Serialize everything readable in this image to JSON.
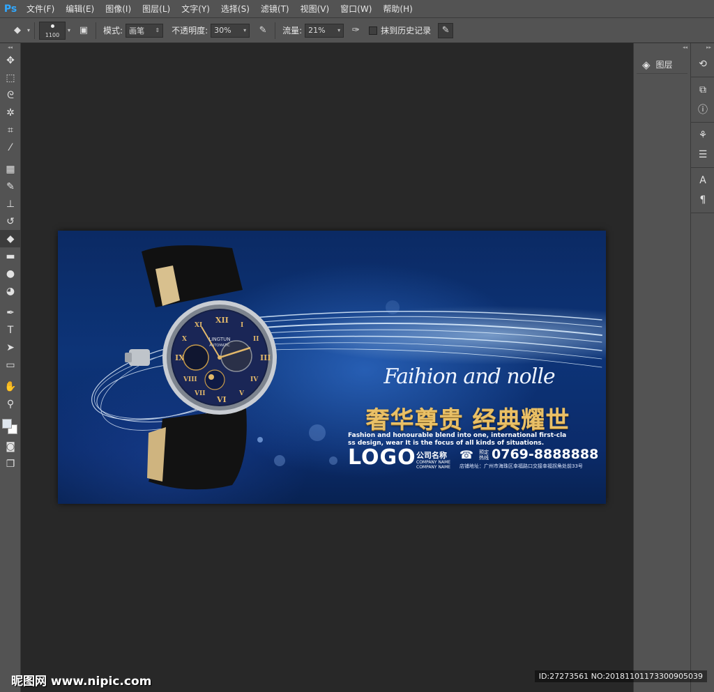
{
  "app": {
    "logo": "Ps"
  },
  "menu": [
    "文件(F)",
    "编辑(E)",
    "图像(I)",
    "图层(L)",
    "文字(Y)",
    "选择(S)",
    "滤镜(T)",
    "视图(V)",
    "窗口(W)",
    "帮助(H)"
  ],
  "options": {
    "brush_size": "1100",
    "mode_label": "模式:",
    "mode_value": "画笔",
    "opacity_label": "不透明度:",
    "opacity_value": "30%",
    "flow_label": "流量:",
    "flow_value": "21%",
    "history_label": "抹到历史记录",
    "history_checked": false
  },
  "tools": [
    {
      "name": "move-tool",
      "glyph": "✥"
    },
    {
      "name": "marquee-tool",
      "glyph": "⬚"
    },
    {
      "name": "lasso-tool",
      "glyph": "ᘓ"
    },
    {
      "name": "magic-wand-tool",
      "glyph": "✲"
    },
    {
      "name": "crop-tool",
      "glyph": "⌗"
    },
    {
      "name": "eyedropper-tool",
      "glyph": "⁄"
    },
    {
      "name": "healing-brush-tool",
      "glyph": "▦"
    },
    {
      "name": "brush-tool",
      "glyph": "✎"
    },
    {
      "name": "clone-stamp-tool",
      "glyph": "⊥"
    },
    {
      "name": "history-brush-tool",
      "glyph": "↺"
    },
    {
      "name": "eraser-tool",
      "glyph": "◆",
      "active": true
    },
    {
      "name": "gradient-tool",
      "glyph": "▬"
    },
    {
      "name": "blur-tool",
      "glyph": "●"
    },
    {
      "name": "dodge-tool",
      "glyph": "◕"
    },
    {
      "name": "pen-tool",
      "glyph": "✒"
    },
    {
      "name": "type-tool",
      "glyph": "T"
    },
    {
      "name": "path-selection-tool",
      "glyph": "➤"
    },
    {
      "name": "shape-tool",
      "glyph": "▭"
    },
    {
      "name": "hand-tool",
      "glyph": "✋"
    },
    {
      "name": "zoom-tool",
      "glyph": "⚲"
    }
  ],
  "colors": {
    "foreground": "#dfe6ee",
    "background": "#ffffff",
    "canvas_bg": "#282828",
    "panel": "#535353",
    "gold": "#e9c067"
  },
  "panels": {
    "layers_label": "图层"
  },
  "document": {
    "script_text": "Faihion and nolle",
    "headline": "奢华尊贵 经典耀世",
    "body_line1": "Fashion and honourable blend into one, international first-cla",
    "body_line2": "ss design, wear It is the focus of all kinds of situations.",
    "logo": "LOGO",
    "company_cn": "公司名称",
    "company_en1": "COMPANY NAME",
    "company_en2": "COMPANY NAME",
    "phone_label1": "预定",
    "phone_label2": "热线",
    "phone": "0769-8888888",
    "address": "店铺地址：广州市海珠区幸福路口交接幸福拐角处前33号",
    "watch_brand": "LINGTUN",
    "watch_sub": "AUTOMATIC"
  },
  "watermark": {
    "left": "昵图网 www.nipic.com",
    "right": "ID:27273561 NO:20181101173300905039"
  }
}
